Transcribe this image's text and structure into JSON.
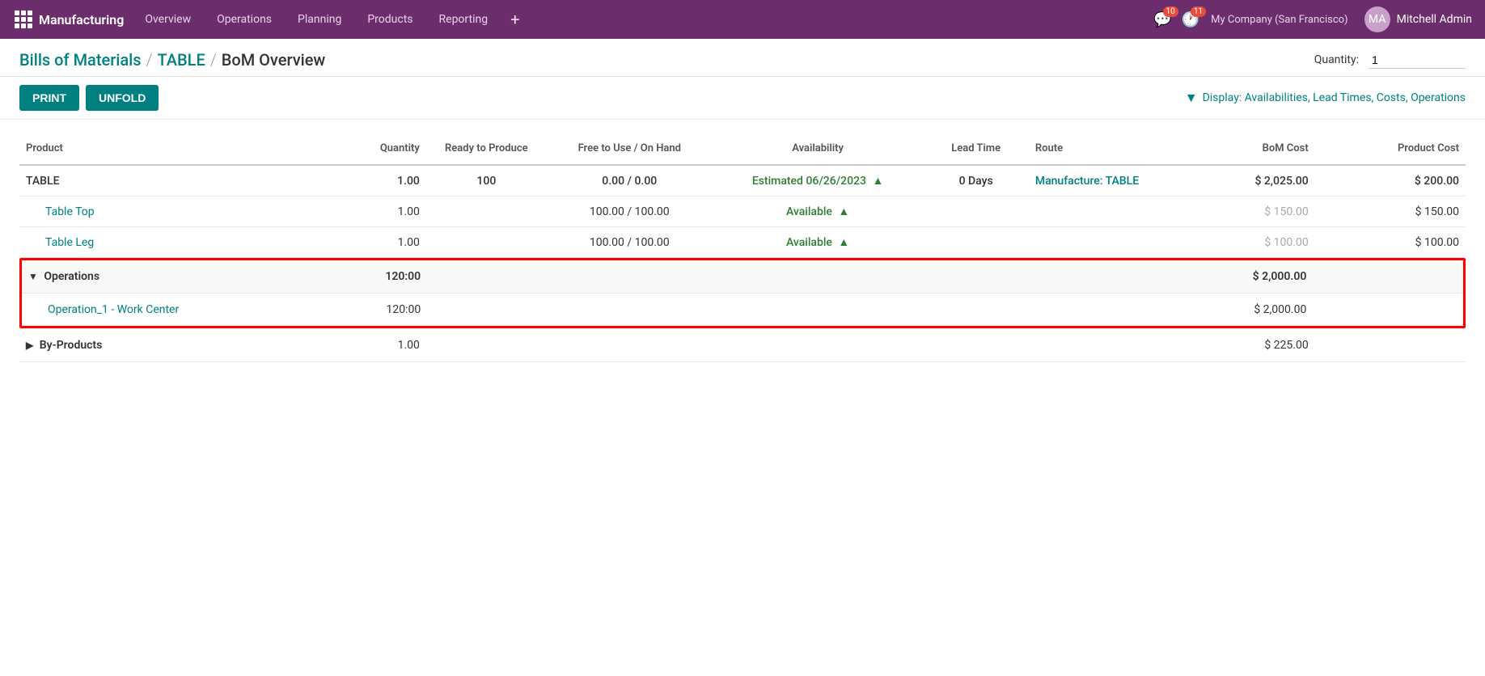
{
  "nav": {
    "app_name": "Manufacturing",
    "items": [
      "Overview",
      "Operations",
      "Planning",
      "Products",
      "Reporting"
    ],
    "plus": "+",
    "messages_count": "10",
    "clock_count": "11",
    "company": "My Company (San Francisco)",
    "user": "Mitchell Admin"
  },
  "breadcrumb": {
    "part1": "Bills of Materials",
    "sep1": "/",
    "part2": "TABLE",
    "sep2": "/",
    "current": "BoM Overview"
  },
  "quantity_label": "Quantity:",
  "quantity_value": "1",
  "buttons": {
    "print": "PRINT",
    "unfold": "UNFOLD"
  },
  "display_filter": "Display: Availabilities, Lead Times, Costs, Operations",
  "table": {
    "headers": {
      "product": "Product",
      "quantity": "Quantity",
      "ready_to_produce": "Ready to Produce",
      "free_to_use": "Free to Use / On Hand",
      "availability": "Availability",
      "lead_time": "Lead Time",
      "route": "Route",
      "bom_cost": "BoM Cost",
      "product_cost": "Product Cost"
    },
    "rows": [
      {
        "type": "main",
        "product": "TABLE",
        "quantity": "1.00",
        "ready_to_produce": "100",
        "free_to_use": "0.00 / 0.00",
        "availability": "Estimated 06/26/2023",
        "availability_type": "estimated",
        "lead_time": "0 Days",
        "route": "Manufacture: TABLE",
        "bom_cost": "$ 2,025.00",
        "product_cost": "$ 200.00"
      },
      {
        "type": "child",
        "product": "Table Top",
        "quantity": "1.00",
        "ready_to_produce": "",
        "free_to_use": "100.00 / 100.00",
        "availability": "Available",
        "availability_type": "available",
        "lead_time": "",
        "route": "",
        "bom_cost": "$ 150.00",
        "product_cost": "$ 150.00"
      },
      {
        "type": "child",
        "product": "Table Leg",
        "quantity": "1.00",
        "ready_to_produce": "",
        "free_to_use": "100.00 / 100.00",
        "availability": "Available",
        "availability_type": "available",
        "lead_time": "",
        "route": "",
        "bom_cost": "$ 100.00",
        "product_cost": "$ 100.00"
      }
    ],
    "operations_section": {
      "header": "Operations",
      "quantity": "120:00",
      "bom_cost": "$ 2,000.00",
      "children": [
        {
          "product": "Operation_1 - Work Center",
          "quantity": "120:00",
          "bom_cost": "$ 2,000.00"
        }
      ]
    },
    "byproducts": {
      "label": "By-Products",
      "quantity": "1.00",
      "bom_cost": "$ 225.00"
    }
  }
}
